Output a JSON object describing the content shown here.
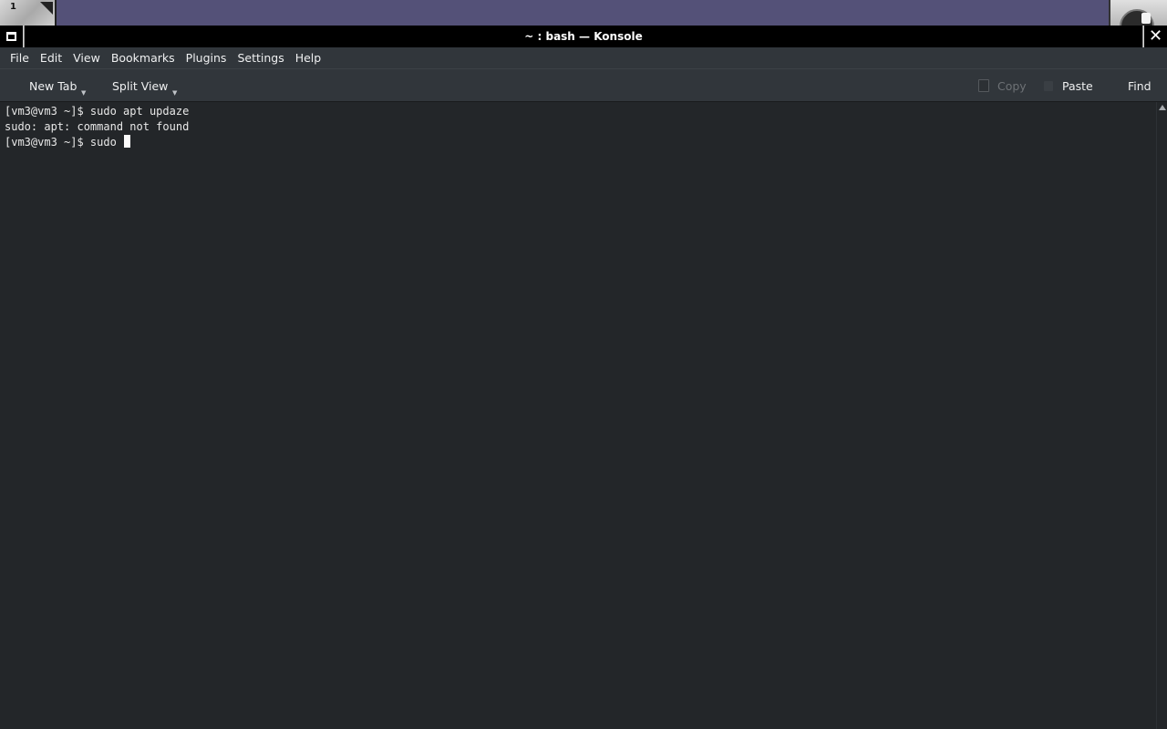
{
  "desktop": {
    "workspace_number": "1"
  },
  "window": {
    "title": "~ : bash — Konsole"
  },
  "menu": {
    "items": [
      "File",
      "Edit",
      "View",
      "Bookmarks",
      "Plugins",
      "Settings",
      "Help"
    ]
  },
  "toolbar": {
    "new_tab": "New Tab",
    "split_view": "Split View",
    "copy": "Copy",
    "paste": "Paste",
    "find": "Find"
  },
  "terminal": {
    "lines": [
      "[vm3@vm3 ~]$ sudo apt updaze",
      "sudo: apt: command not found",
      "[vm3@vm3 ~]$ sudo "
    ]
  }
}
